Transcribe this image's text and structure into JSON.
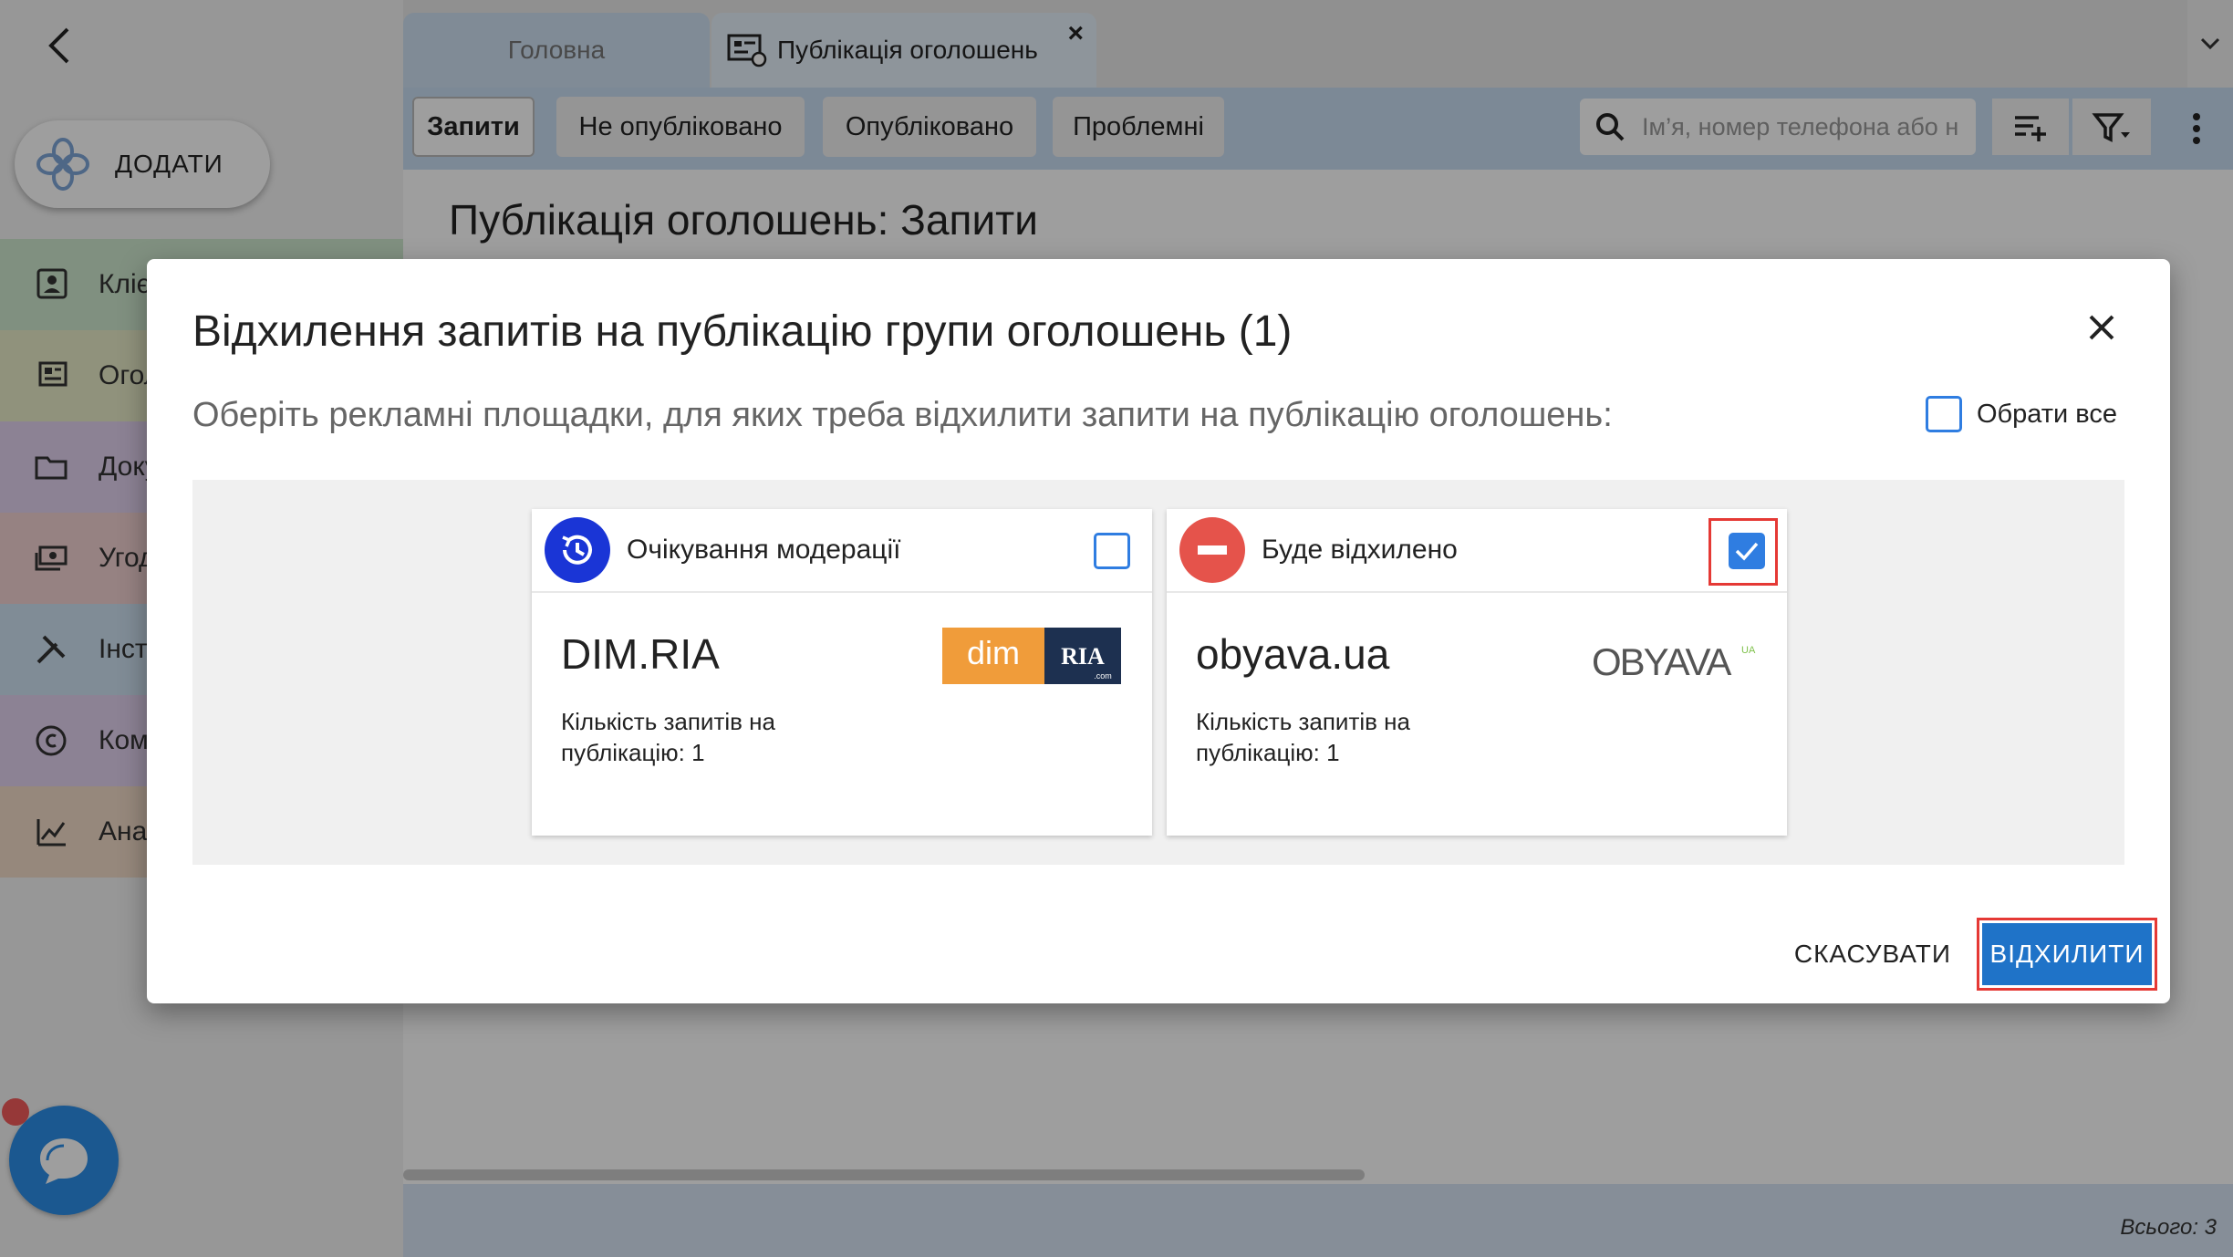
{
  "sidebar": {
    "add_label": "ДОДАТИ",
    "items": [
      {
        "label": "Клієнти",
        "icon": "contacts-icon",
        "color": "#cfe8cf"
      },
      {
        "label": "Оголошення",
        "icon": "listings-icon",
        "color": "#e8ecc8"
      },
      {
        "label": "Документи",
        "icon": "folder-icon",
        "color": "#e3d2ef"
      },
      {
        "label": "Угоди",
        "icon": "money-icon",
        "color": "#f2d2d2"
      },
      {
        "label": "Інструменти",
        "icon": "tools-icon",
        "color": "#cfe2f3"
      },
      {
        "label": "Комісії",
        "icon": "copyright-icon",
        "color": "#e3d2ef"
      },
      {
        "label": "Аналітика",
        "icon": "analytics-icon",
        "color": "#f3dcc8"
      }
    ]
  },
  "tabs": [
    {
      "label": "Головна"
    },
    {
      "label": "Публікація оголошень"
    }
  ],
  "toolbar": {
    "filters": [
      "Запити",
      "Не опубліковано",
      "Опубліковано",
      "Проблемні"
    ],
    "search_placeholder": "Ім’я, номер телефона або н"
  },
  "page": {
    "title": "Публікація оголошень: Запити",
    "total": "Всього: 3"
  },
  "dialog": {
    "title": "Відхилення запитів на публікацію групи оголошень (1)",
    "subtitle": "Оберіть рекламні площадки, для яких треба відхилити запити на публікацію оголошень:",
    "select_all_label": "Обрати все",
    "cards": [
      {
        "status": "Очікування модерації",
        "status_icon": "history-icon",
        "status_color": "#1a35d6",
        "name": "DIM.RIA",
        "count_text": "Кількість запитів на публікацію: 1",
        "checked": false,
        "logo": {
          "left": "dim",
          "right": "RIA",
          "small": ".com"
        }
      },
      {
        "status": "Буде відхилено",
        "status_icon": "minus-circle-icon",
        "status_color": "#e5534b",
        "name": "obyava.ua",
        "count_text": "Кількість запитів на публікацію: 1",
        "checked": true,
        "logo": {
          "text": "OBYAVA",
          "small": "UA"
        }
      }
    ],
    "cancel_label": "СКАСУВАТИ",
    "reject_label": "ВІДХИЛИТИ"
  }
}
